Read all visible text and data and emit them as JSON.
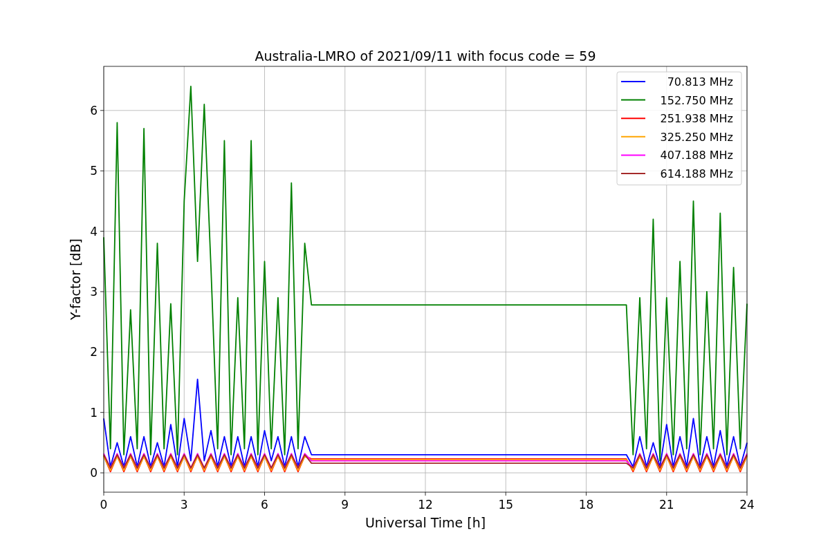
{
  "chart_data": {
    "type": "line",
    "title": "Australia-LMRO of 2021/09/11 with focus code = 59",
    "xlabel": "Universal Time [h]",
    "ylabel": "Y-factor [dB]",
    "x": [
      0,
      0.25,
      0.5,
      0.75,
      1,
      1.25,
      1.5,
      1.75,
      2,
      2.25,
      2.5,
      2.75,
      3,
      3.25,
      3.5,
      3.75,
      4,
      4.25,
      4.5,
      4.75,
      5,
      5.25,
      5.5,
      5.75,
      6,
      6.25,
      6.5,
      6.75,
      7,
      7.25,
      7.5,
      7.75,
      19.5,
      19.75,
      20,
      20.25,
      20.5,
      20.75,
      21,
      21.25,
      21.5,
      21.75,
      22,
      22.25,
      22.5,
      22.75,
      23,
      23.25,
      23.5,
      23.75,
      24
    ],
    "series": [
      {
        "name": " 70.813 MHz",
        "color": "#0000ff",
        "values": [
          0.9,
          0.1,
          0.5,
          0.1,
          0.6,
          0.1,
          0.6,
          0.1,
          0.5,
          0.1,
          0.8,
          0.1,
          0.9,
          0.2,
          1.55,
          0.2,
          0.7,
          0.1,
          0.6,
          0.1,
          0.6,
          0.1,
          0.6,
          0.1,
          0.7,
          0.2,
          0.6,
          0.1,
          0.6,
          0.1,
          0.6,
          0.3,
          0.3,
          0.1,
          0.6,
          0.1,
          0.5,
          0.1,
          0.8,
          0.1,
          0.6,
          0.1,
          0.9,
          0.1,
          0.6,
          0.1,
          0.7,
          0.1,
          0.6,
          0.1,
          0.5
        ]
      },
      {
        "name": "152.750 MHz",
        "color": "#008000",
        "values": [
          3.9,
          0.4,
          5.8,
          0.3,
          2.7,
          0.4,
          5.7,
          0.3,
          3.8,
          0.4,
          2.8,
          0.3,
          4.5,
          6.4,
          3.5,
          6.1,
          3.4,
          0.4,
          5.5,
          0.3,
          2.9,
          0.4,
          5.5,
          0.3,
          3.5,
          0.4,
          2.9,
          0.3,
          4.8,
          0.4,
          3.8,
          2.78,
          2.78,
          0.3,
          2.9,
          0.4,
          4.2,
          0.2,
          2.9,
          0.3,
          3.5,
          0.4,
          4.5,
          0.3,
          3.0,
          0.4,
          4.3,
          0.3,
          3.4,
          0.4,
          2.8
        ]
      },
      {
        "name": "251.938 MHz",
        "color": "#ff0000",
        "values": [
          0.28,
          0.02,
          0.28,
          0.02,
          0.28,
          0.02,
          0.28,
          0.02,
          0.28,
          0.02,
          0.28,
          0.02,
          0.28,
          0.02,
          0.28,
          0.02,
          0.28,
          0.02,
          0.28,
          0.02,
          0.28,
          0.02,
          0.28,
          0.02,
          0.28,
          0.02,
          0.28,
          0.02,
          0.28,
          0.02,
          0.28,
          0.23,
          0.23,
          0.02,
          0.28,
          0.02,
          0.28,
          0.02,
          0.28,
          0.02,
          0.28,
          0.02,
          0.28,
          0.02,
          0.28,
          0.02,
          0.28,
          0.02,
          0.28,
          0.02,
          0.28
        ]
      },
      {
        "name": "325.250 MHz",
        "color": "#ffa500",
        "values": [
          0.27,
          0.04,
          0.27,
          0.04,
          0.27,
          0.04,
          0.27,
          0.04,
          0.27,
          0.04,
          0.27,
          0.04,
          0.27,
          0.04,
          0.27,
          0.04,
          0.27,
          0.04,
          0.27,
          0.04,
          0.27,
          0.04,
          0.27,
          0.04,
          0.27,
          0.04,
          0.27,
          0.04,
          0.27,
          0.04,
          0.27,
          0.22,
          0.22,
          0.04,
          0.27,
          0.04,
          0.27,
          0.04,
          0.27,
          0.04,
          0.27,
          0.04,
          0.27,
          0.04,
          0.27,
          0.04,
          0.27,
          0.04,
          0.27,
          0.04,
          0.27
        ]
      },
      {
        "name": "407.188 MHz",
        "color": "#ff00ff",
        "values": [
          0.32,
          0.08,
          0.32,
          0.08,
          0.32,
          0.08,
          0.32,
          0.08,
          0.32,
          0.08,
          0.32,
          0.08,
          0.32,
          0.08,
          0.32,
          0.08,
          0.32,
          0.08,
          0.32,
          0.08,
          0.32,
          0.08,
          0.32,
          0.08,
          0.32,
          0.08,
          0.32,
          0.08,
          0.32,
          0.08,
          0.32,
          0.2,
          0.2,
          0.08,
          0.32,
          0.08,
          0.32,
          0.08,
          0.32,
          0.08,
          0.32,
          0.08,
          0.32,
          0.08,
          0.32,
          0.08,
          0.32,
          0.08,
          0.32,
          0.08,
          0.32
        ]
      },
      {
        "name": "614.188 MHz",
        "color": "#a52a2a",
        "values": [
          0.3,
          0.08,
          0.3,
          0.08,
          0.3,
          0.08,
          0.3,
          0.08,
          0.3,
          0.08,
          0.3,
          0.08,
          0.3,
          0.08,
          0.3,
          0.08,
          0.3,
          0.08,
          0.3,
          0.08,
          0.3,
          0.08,
          0.3,
          0.08,
          0.3,
          0.08,
          0.3,
          0.08,
          0.3,
          0.08,
          0.3,
          0.16,
          0.16,
          0.08,
          0.3,
          0.08,
          0.3,
          0.08,
          0.3,
          0.08,
          0.3,
          0.08,
          0.3,
          0.08,
          0.3,
          0.08,
          0.3,
          0.08,
          0.3,
          0.08,
          0.3
        ]
      }
    ],
    "xlim": [
      0,
      24
    ],
    "ylim": [
      -0.32,
      6.73
    ],
    "xticks": [
      0,
      3,
      6,
      9,
      12,
      15,
      18,
      21,
      24
    ],
    "yticks": [
      0,
      1,
      2,
      3,
      4,
      5,
      6
    ],
    "grid": true,
    "legend": true
  }
}
